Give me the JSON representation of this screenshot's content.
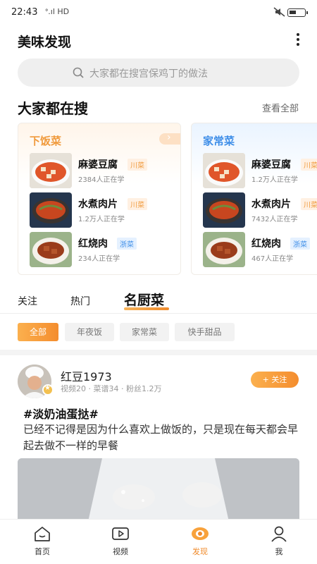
{
  "status": {
    "time": "22:43",
    "signal": "ᐤ.ıl HD"
  },
  "header": {
    "title": "美味发现"
  },
  "search": {
    "placeholder": "大家都在搜宫保鸡丁的做法"
  },
  "hot": {
    "title": "大家都在搜",
    "see_all": "查看全部",
    "cards": [
      {
        "title": "下饭菜",
        "items": [
          {
            "name": "麻婆豆腐",
            "tag": "川菜",
            "sub": "2384人正在学"
          },
          {
            "name": "水煮肉片",
            "tag": "川菜",
            "sub": "1.2万人正在学"
          },
          {
            "name": "红烧肉",
            "tag": "浙菜",
            "sub": "234人正在学"
          }
        ]
      },
      {
        "title": "家常菜",
        "items": [
          {
            "name": "麻婆豆腐",
            "tag": "川菜",
            "sub": "1.2万人正在学"
          },
          {
            "name": "水煮肉片",
            "tag": "川菜",
            "sub": "7432人正在学"
          },
          {
            "name": "红烧肉",
            "tag": "浙菜",
            "sub": "467人正在学"
          }
        ]
      }
    ]
  },
  "tabs": [
    "关注",
    "热门",
    "名厨菜"
  ],
  "chips": [
    "全部",
    "年夜饭",
    "家常菜",
    "快手甜品"
  ],
  "post": {
    "username": "红豆1973",
    "stats": "视频20 · 菜谱34 · 粉丝1.2万",
    "follow": "+ 关注",
    "title": "#淡奶油蛋挞#",
    "body": "已经不记得是因为什么喜欢上做饭的，只是现在每天都会早起去做不一样的早餐"
  },
  "nav": [
    "首页",
    "视频",
    "发现",
    "我"
  ],
  "colors": {
    "accent": "#f08b2c",
    "blue": "#3e8ee8"
  }
}
